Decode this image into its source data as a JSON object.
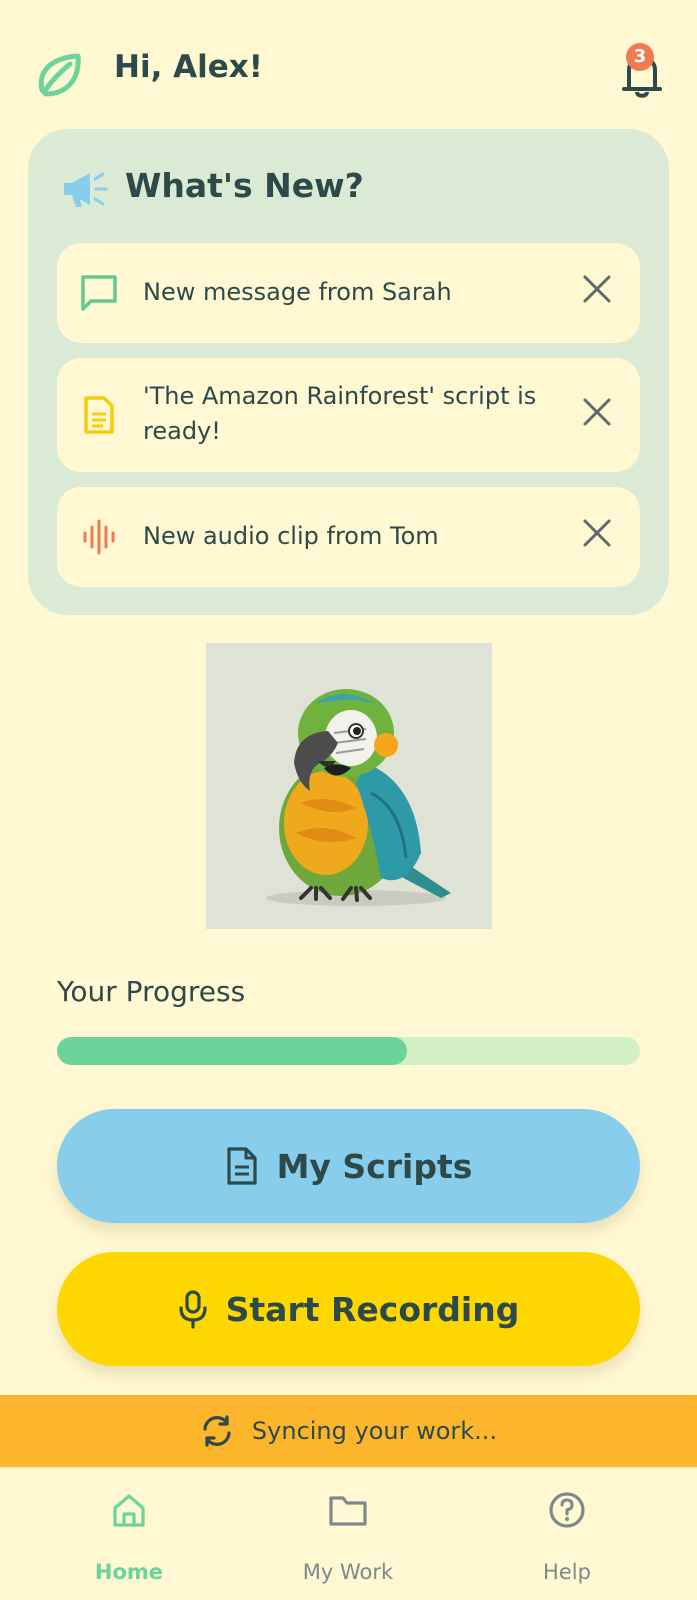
{
  "header": {
    "greeting": "Hi, Alex!",
    "notification_count": "3"
  },
  "whats_new": {
    "title": "What's New?",
    "items": [
      {
        "icon": "message-icon",
        "text": "New message from Sarah",
        "color": "#5FCB8F"
      },
      {
        "icon": "document-icon",
        "text": "'The Amazon Rainforest' script is ready!",
        "color": "#F5CE0B"
      },
      {
        "icon": "audio-wave-icon",
        "text": "New audio clip from Tom",
        "color": "#F07A4F"
      }
    ]
  },
  "progress": {
    "label": "Your Progress",
    "value": 0.6
  },
  "buttons": {
    "scripts_label": "My Scripts",
    "record_label": "Start Recording"
  },
  "sync": {
    "text": "Syncing your work..."
  },
  "tabs": [
    {
      "label": "Home",
      "icon": "home-icon",
      "active": true
    },
    {
      "label": "My Work",
      "icon": "folder-icon",
      "active": false
    },
    {
      "label": "Help",
      "icon": "help-icon",
      "active": false
    }
  ],
  "colors": {
    "background": "#FFF8D2",
    "card": "#DAEAD5",
    "accent_green": "#6CD49A",
    "scripts_button": "#88CDEB",
    "record_button": "#FED600",
    "sync_bar": "#FDB52B"
  }
}
